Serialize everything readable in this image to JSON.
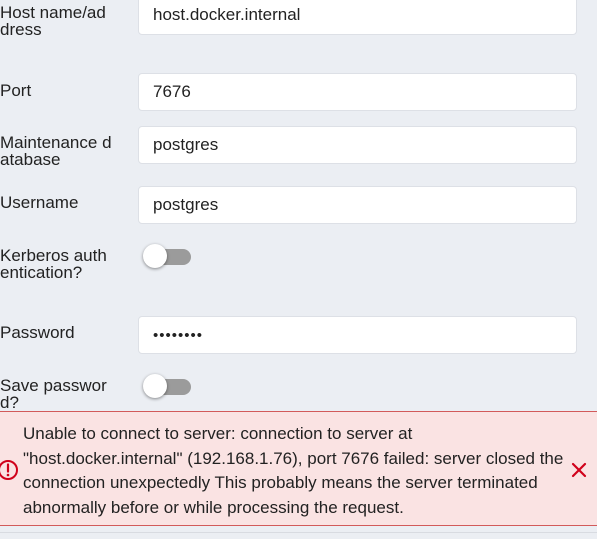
{
  "form": {
    "host_label": "Host name/address",
    "host_value": "host.docker.internal",
    "port_label": "Port",
    "port_value": "7676",
    "maintenance_db_label": "Maintenance database",
    "maintenance_db_value": "postgres",
    "username_label": "Username",
    "username_value": "postgres",
    "kerberos_label": "Kerberos authentication?",
    "kerberos_enabled": false,
    "password_label": "Password",
    "password_value": "••••••••",
    "save_password_label": "Save password?",
    "save_password_enabled": false
  },
  "error": {
    "message": "Unable to connect to server: connection to server at \"host.docker.internal\" (192.168.1.76), port 7676 failed: server closed the connection unexpectedly This probably means the server terminated abnormally before or while processing the request.",
    "icon": "alert-circle-icon",
    "close_icon": "close-icon",
    "color": "#d0021b",
    "background": "#fae3e3"
  }
}
